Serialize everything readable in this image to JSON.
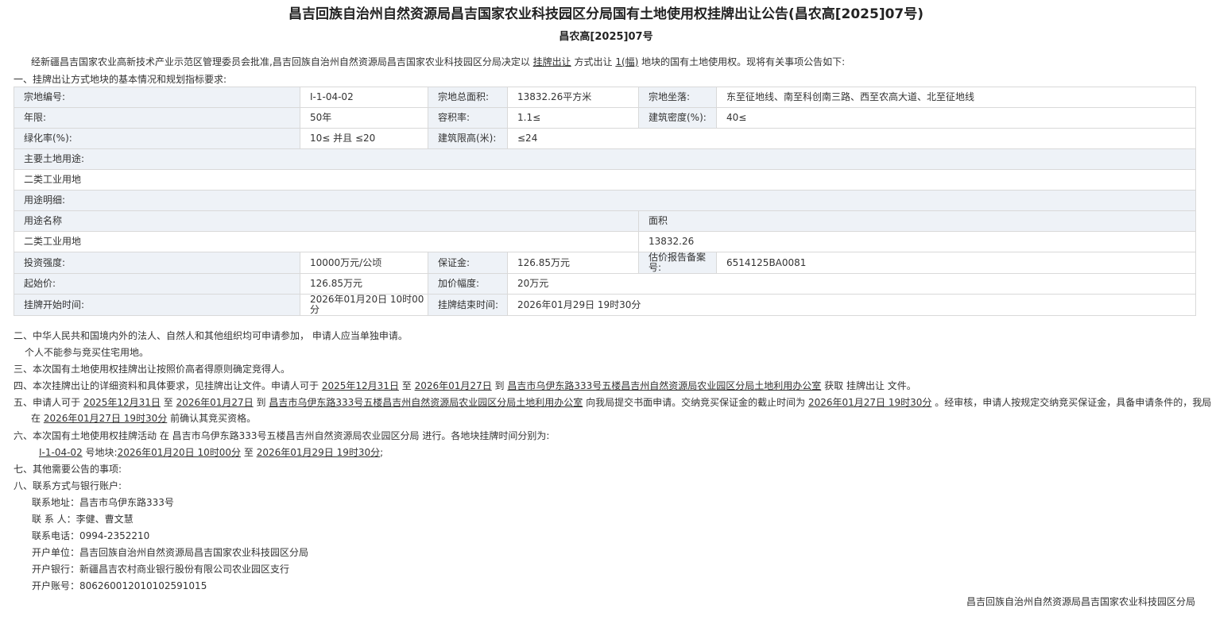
{
  "title": "昌吉回族自治州自然资源局昌吉国家农业科技园区分局国有土地使用权挂牌出让公告(昌农高[2025]07号)",
  "subtitle": "昌农高[2025]07号",
  "intro": {
    "pre": "经新疆昌吉国家农业高新技术产业示范区管理委员会批准,昌吉回族自治州自然资源局昌吉国家农业科技园区分局决定以",
    "method": "挂牌出让",
    "mid": "方式出让",
    "count": "1(幅)",
    "post": "地块的国有土地使用权。现将有关事项公告如下:"
  },
  "section1": "一、挂牌出让方式地块的基本情况和规划指标要求:",
  "table": {
    "row1": [
      "宗地编号:",
      "I-1-04-02",
      "宗地总面积:",
      "13832.26平方米",
      "宗地坐落:",
      "东至征地线、南至科创南三路、西至农高大道、北至征地线"
    ],
    "row2": [
      "年限:",
      "50年",
      "容积率:",
      "1.1≤",
      "建筑密度(%):",
      "40≤"
    ],
    "row3": [
      "绿化率(%):",
      "10≤ 并且 ≤20",
      "建筑限高(米):",
      "≤24"
    ],
    "main_use_label": "主要土地用途:",
    "main_use_value": "二类工业用地",
    "use_detail_label": "用途明细:",
    "use_header": [
      "用途名称",
      "面积"
    ],
    "use_row": [
      "二类工业用地",
      "13832.26"
    ],
    "row_invest": [
      "投资强度:",
      "10000万元/公顷",
      "保证金:",
      "126.85万元",
      "估价报告备案号:",
      "6514125BA0081"
    ],
    "row_price": [
      "起始价:",
      "126.85万元",
      "加价幅度:",
      "20万元"
    ],
    "row_time": [
      "挂牌开始时间:",
      "2026年01月20日 10时00分",
      "挂牌结束时间:",
      "2026年01月29日 19时30分"
    ]
  },
  "s2a": "二、中华人民共和国境内外的法人、自然人和其他组织均可申请参加， 申请人应当单独申请。",
  "s2b": "个人不能参与竞买住宅用地。",
  "s3": "三、本次国有土地使用权挂牌出让按照价高者得原则确定竞得人。",
  "s4": {
    "p1": "四、本次挂牌出让的详细资料和具体要求，见挂牌出让文件。申请人可于",
    "d1": "2025年12月31日",
    "p2": "至",
    "d2": "2026年01月27日",
    "p3": "到",
    "place": "昌吉市乌伊东路333号五楼昌吉州自然资源局农业园区分局土地利用办公室",
    "p4": "获取 挂牌出让 文件。"
  },
  "s5": {
    "p1": "五、申请人可于",
    "d1": "2025年12月31日",
    "p2": "至",
    "d2": "2026年01月27日",
    "p3": "到",
    "place": "昌吉市乌伊东路333号五楼昌吉州自然资源局农业园区分局土地利用办公室",
    "p4": "向我局提交书面申请。交纳竞买保证金的截止时间为",
    "deadline": "2026年01月27日 19时30分",
    "p5": "。经审核，申请人按规定交纳竞买保证金，具备申请条件的，我局将",
    "l2a": "在",
    "confirm": "2026年01月27日 19时30分",
    "l2b": "前确认其竞买资格。"
  },
  "s6": {
    "p1": "六、本次国有土地使用权挂牌活动 在 昌吉市乌伊东路333号五楼昌吉州自然资源局农业园区分局 进行。各地块挂牌时间分别为:",
    "code": "I-1-04-02",
    "p2": "号地块:",
    "start": "2026年01月20日 10时00分",
    "p3": "至",
    "end": "2026年01月29日 19时30分",
    "p4": ";"
  },
  "s7": "七、其他需要公告的事项:",
  "s8": "八、联系方式与银行账户:",
  "contacts": [
    "联系地址：昌吉市乌伊东路333号",
    "联 系 人：李健、曹文慧",
    "联系电话：0994-2352210",
    "开户单位：昌吉回族自治州自然资源局昌吉国家农业科技园区分局",
    "开户银行：新疆昌吉农村商业银行股份有限公司农业园区支行",
    "开户账号：806260012010102591015"
  ],
  "footer": "昌吉回族自治州自然资源局昌吉国家农业科技园区分局"
}
